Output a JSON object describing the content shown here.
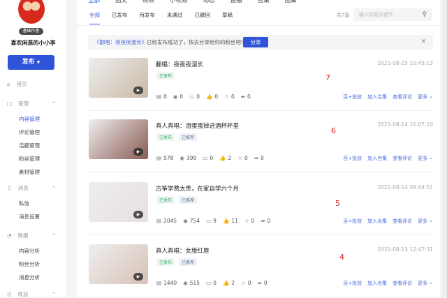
{
  "sidebar": {
    "badge": "基础作者",
    "username": "喜欢闲逛的小小李",
    "publish_label": "发布",
    "groups": [
      {
        "label": "首页",
        "icon": "⌂"
      },
      {
        "label": "管理",
        "icon": "▢"
      },
      {
        "label": "消息",
        "icon": "♫"
      },
      {
        "label": "数据",
        "icon": "◔"
      },
      {
        "label": "收益",
        "icon": "◎"
      }
    ],
    "items": {
      "manage": [
        "内容管理",
        "评论管理",
        "话题管理",
        "粉丝管理",
        "素材管理"
      ],
      "message": [
        "私信",
        "消息设置"
      ],
      "data": [
        "内容分析",
        "粉丝分析",
        "消息分析"
      ]
    }
  },
  "top_tabs": [
    "全部",
    "图文",
    "视频",
    "小视频",
    "动态",
    "直播",
    "合集",
    "图集"
  ],
  "status_tabs": [
    "全部",
    "已发布",
    "待发布",
    "未通过",
    "已撤回",
    "草稿"
  ],
  "count": "共7篇",
  "search": {
    "placeholder": "输入标题关键字"
  },
  "notice": {
    "link": "《翻唱：夜夜夜漫长》",
    "text": "已经发布成功了，快去分享给你的粉丝吧！",
    "share": "分享"
  },
  "actions": [
    "百+投放",
    "加入合集",
    "查看评论",
    "更多"
  ],
  "articles": [
    {
      "title": "翻唱：夜夜夜漫长",
      "time": "2021-08-15 10:45:13",
      "tags": [
        "已发布"
      ],
      "stats": [
        "0",
        "0",
        "0",
        "0",
        "0",
        "0"
      ],
      "annotation": "7",
      "thumb": "#c9b9a6"
    },
    {
      "title": "真人真唱：泪蛋蛋掉进酒杯杯里",
      "time": "2021-08-14 16:07:10",
      "tags": [
        "已发布",
        "已推荐"
      ],
      "stats": [
        "578",
        "399",
        "0",
        "2",
        "0",
        "0"
      ],
      "annotation": "6",
      "thumb": "#8a5a52"
    },
    {
      "title": "古筝学费太贵，在家自学六个月",
      "time": "2021-08-14 08:44:51",
      "tags": [
        "已发布",
        "已推荐"
      ],
      "stats": [
        "2045",
        "754",
        "9",
        "11",
        "0",
        "0"
      ],
      "annotation": "5",
      "thumb": "#e8dfe0"
    },
    {
      "title": "真人真唱：女版红唇",
      "time": "2021-08-13 12:47:31",
      "tags": [
        "已发布",
        "已推荐"
      ],
      "stats": [
        "1440",
        "515",
        "0",
        "2",
        "0",
        "0"
      ],
      "annotation": "4",
      "thumb": "#d7c1b6"
    }
  ]
}
